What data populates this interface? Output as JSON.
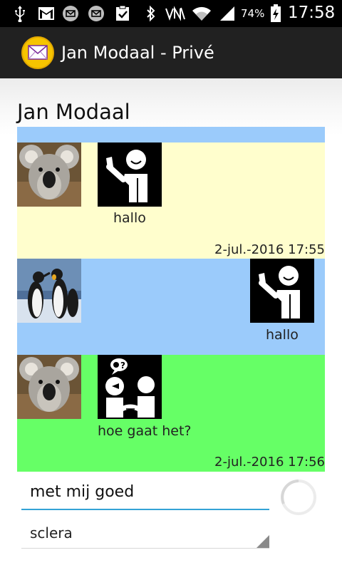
{
  "status_bar": {
    "battery_percent": "74%",
    "time": "17:58",
    "icons": [
      "usb-icon",
      "gmail-icon",
      "sms-icon",
      "sms-icon",
      "clipboard-check-icon",
      "bluetooth-icon",
      "nfc-icon",
      "wifi-icon",
      "signal-icon",
      "battery-charging-icon"
    ]
  },
  "action_bar": {
    "title": "Jan Modaal - Privé",
    "app_icon": "envelope-icon"
  },
  "conversation": {
    "contact_name": "Jan Modaal",
    "messages": [
      {
        "sender": "contact",
        "avatar": "koala-photo",
        "pictogram": "waving-person-pictogram",
        "text": "hallo",
        "timestamp": "2-jul.-2016 17:55",
        "background": "#fffecd"
      },
      {
        "sender": "me",
        "avatar": "penguins-photo",
        "pictogram": "waving-person-pictogram",
        "text": "hallo",
        "timestamp": "",
        "background": "#9bcbfb"
      },
      {
        "sender": "contact",
        "avatar": "koala-photo",
        "pictogram": "handshake-question-pictogram",
        "text": "hoe gaat het?",
        "timestamp": "2-jul.-2016 17:56",
        "background": "#66ff66"
      }
    ],
    "top_strip_color": "#9bcbfb"
  },
  "composer": {
    "input_value": "met mij goed",
    "picto_set": "sclera",
    "underline_color": "#33a3d6"
  }
}
